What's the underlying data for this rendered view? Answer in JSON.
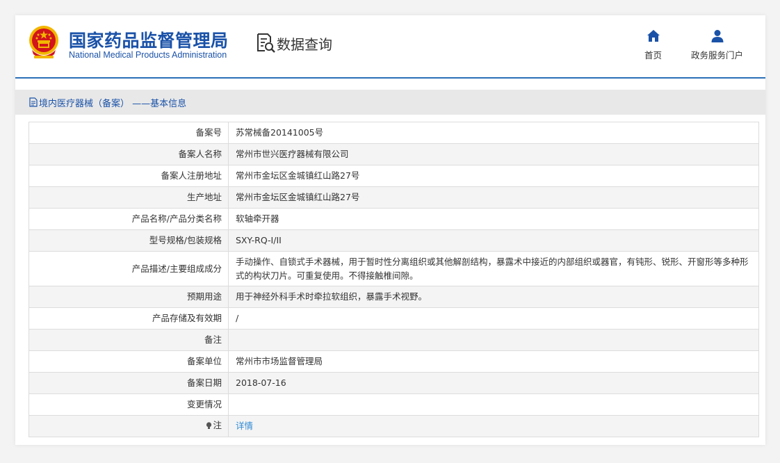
{
  "header": {
    "brand_cn": "国家药品监督管理局",
    "brand_en": "National Medical Products Administration",
    "query_label": "数据查询",
    "nav": [
      {
        "label": "首页",
        "icon": "home-icon"
      },
      {
        "label": "政务服务门户",
        "icon": "user-icon"
      }
    ]
  },
  "section": {
    "title": "境内医疗器械（备案） ——基本信息",
    "icon": "document-icon"
  },
  "record": [
    {
      "key": "备案号",
      "value": "苏常械备20141005号"
    },
    {
      "key": "备案人名称",
      "value": "常州市世兴医疗器械有限公司"
    },
    {
      "key": "备案人注册地址",
      "value": "常州市金坛区金城镇红山路27号"
    },
    {
      "key": "生产地址",
      "value": "常州市金坛区金城镇红山路27号"
    },
    {
      "key": "产品名称/产品分类名称",
      "value": "软轴牵开器"
    },
    {
      "key": "型号规格/包装规格",
      "value": "SXY-RQ-I/II"
    },
    {
      "key": "产品描述/主要组成成分",
      "value": "手动操作、自锁式手术器械，用于暂时性分离组织或其他解剖结构，暴露术中接近的内部组织或器官，有钝形、锐形、开窗形等多种形式的构状刀片。可重复使用。不得接触椎间隙。"
    },
    {
      "key": "预期用途",
      "value": "用于神经外科手术时牵拉软组织，暴露手术视野。"
    },
    {
      "key": "产品存储及有效期",
      "value": "/"
    },
    {
      "key": "备注",
      "value": ""
    },
    {
      "key": "备案单位",
      "value": "常州市市场监督管理局"
    },
    {
      "key": "备案日期",
      "value": "2018-07-16"
    },
    {
      "key": "变更情况",
      "value": ""
    },
    {
      "key": "注",
      "value": "详情"
    }
  ],
  "colors": {
    "brand_blue": "#1a52a8",
    "link_blue": "#2f8ad4",
    "emblem_red": "#d2141c",
    "emblem_gold": "#f2b600"
  }
}
